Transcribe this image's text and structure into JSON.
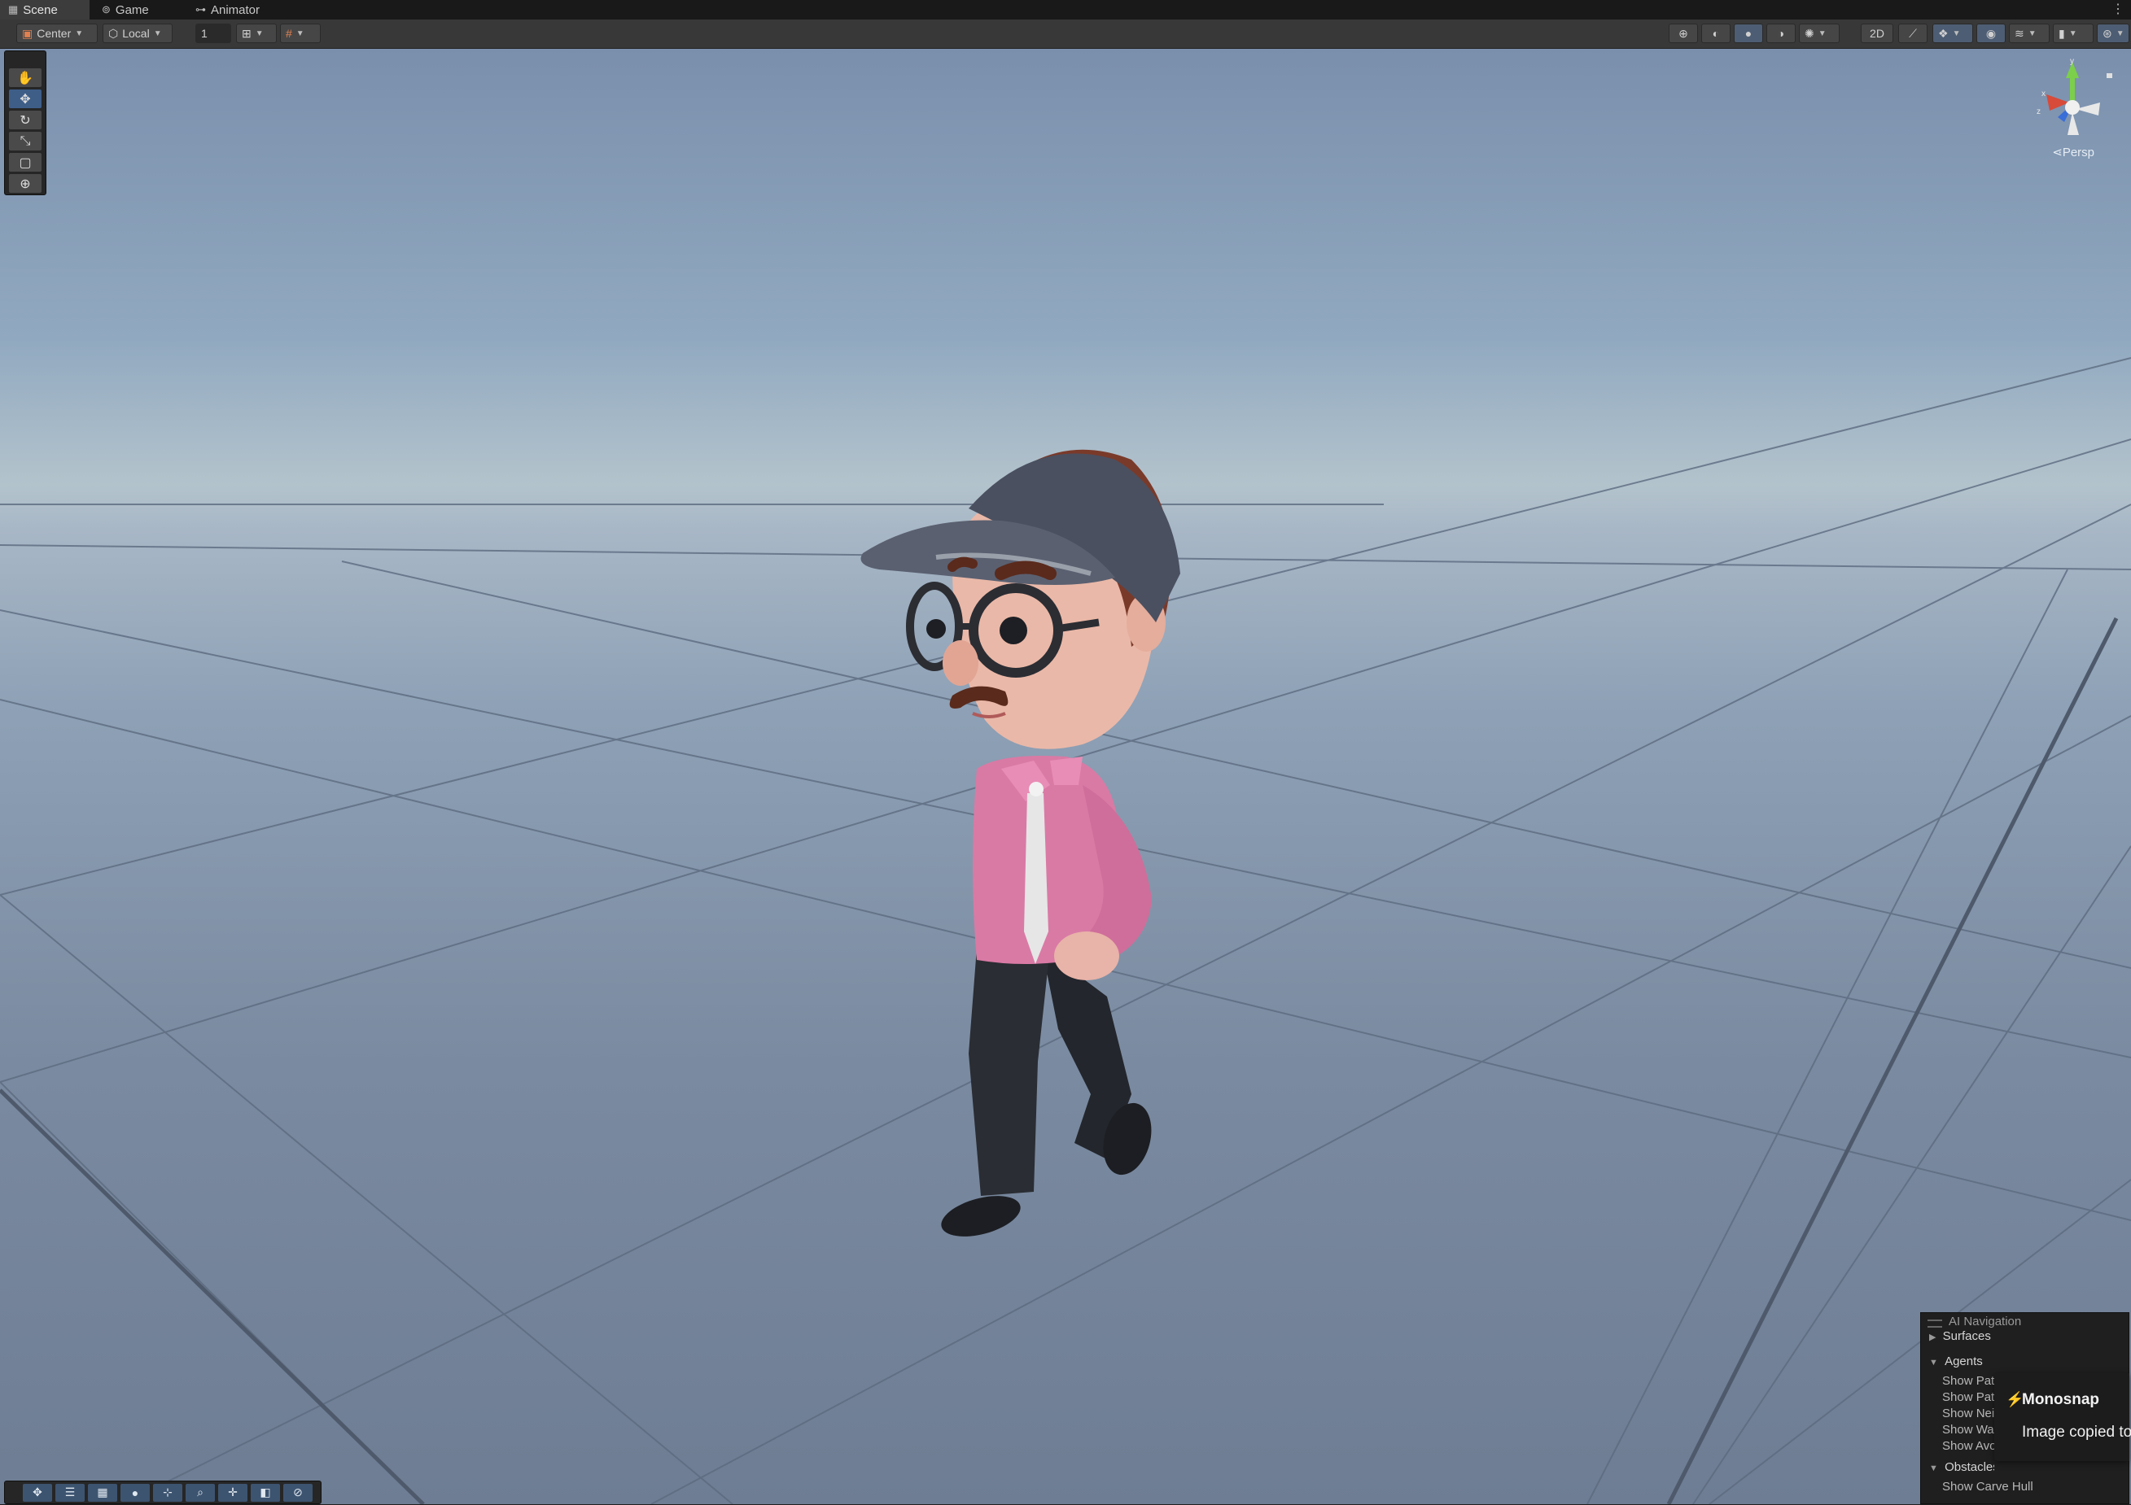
{
  "tabs": [
    {
      "label": "Scene",
      "icon": "grid-icon"
    },
    {
      "label": "Game",
      "icon": "gamepad-icon"
    },
    {
      "label": "Animator",
      "icon": "animator-icon"
    }
  ],
  "toolbar": {
    "pivot_label": "Center",
    "space_label": "Local",
    "grid_snap_value": "1"
  },
  "tool_palette": [
    "hand-tool",
    "move-tool",
    "rotate-tool",
    "scale-tool",
    "rect-tool",
    "transform-tool"
  ],
  "scene_view": {
    "projection_label": "Persp",
    "gizmo_axes": [
      "x",
      "y",
      "z"
    ]
  },
  "ai_navigation": {
    "title": "AI Navigation",
    "surfaces_label": "Surfaces",
    "agents_label": "Agents",
    "agent_items": [
      "Show Path Polygons",
      "Show Path Query Nodes",
      "Show Neighbours",
      "Show Walkable Mode",
      "Show Avoidance"
    ],
    "obstacles_label": "Obstacles",
    "obstacle_items": [
      "Show Carve Hull"
    ]
  },
  "toast": {
    "app": "Monosnap",
    "message": "Image copied to"
  },
  "colors": {
    "accent": "#3e5e88",
    "shirt": "#d97aa5",
    "cap": "#4a5060",
    "pants": "#25282e",
    "sky_top": "#7a8fac",
    "horizon": "#b3c3cc"
  }
}
